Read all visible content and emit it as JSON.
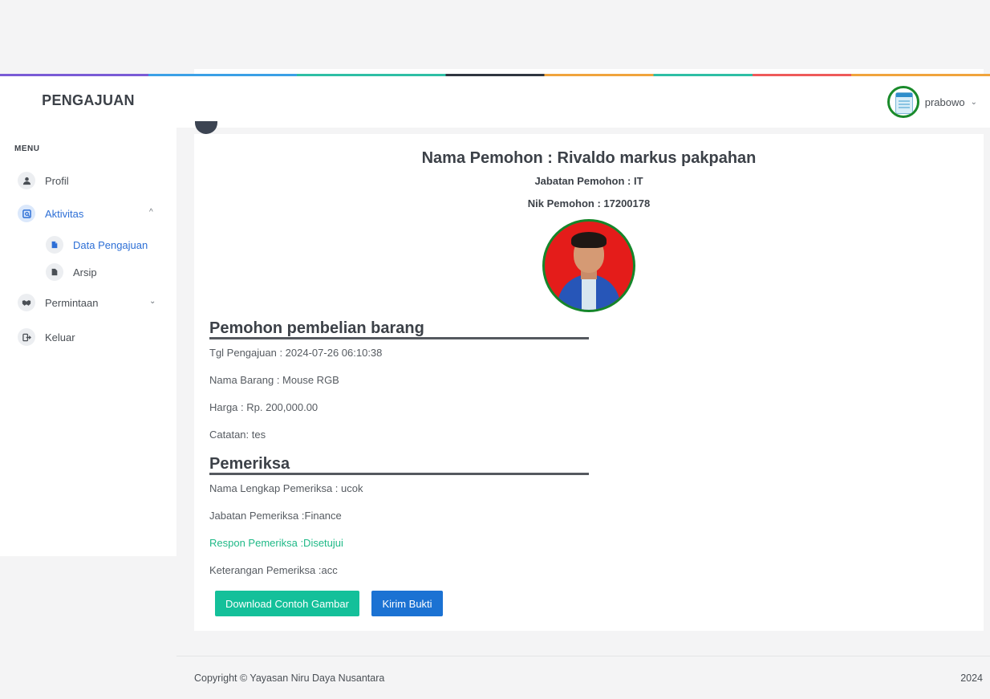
{
  "sidebar": {
    "brand": "PENGAJUAN",
    "menu_label": "MENU",
    "items": [
      {
        "label": "Profil",
        "icon": "user-icon"
      },
      {
        "label": "Aktivitas",
        "icon": "activity-icon"
      },
      {
        "label": "Permintaan",
        "icon": "handshake-icon"
      },
      {
        "label": "Keluar",
        "icon": "logout-icon"
      }
    ],
    "subitems": [
      {
        "label": "Data Pengajuan",
        "icon": "file-icon"
      },
      {
        "label": "Arsip",
        "icon": "file-icon"
      }
    ]
  },
  "header": {
    "username": "prabowo"
  },
  "applicant": {
    "name_line": "Nama Pemohon : Rivaldo markus pakpahan",
    "position_line": "Jabatan Pemohon : IT",
    "nik_line": "Nik Pemohon : 17200178"
  },
  "purchase": {
    "heading": "Pemohon pembelian barang",
    "date": "Tgl Pengajuan : 2024-07-26 06:10:38",
    "item": "Nama Barang : Mouse RGB",
    "price": "Harga : Rp. 200,000.00",
    "note": "Catatan: tes"
  },
  "reviewer": {
    "heading": "Pemeriksa",
    "name": "Nama Lengkap Pemeriksa : ucok",
    "position": "Jabatan Pemeriksa :Finance",
    "response": "Respon Pemeriksa :Disetujui",
    "remark": "Keterangan Pemeriksa :acc"
  },
  "actions": {
    "download": "Download Contoh Gambar",
    "send": "Kirim Bukti"
  },
  "footer": {
    "copyright": "Copyright © Yayasan Niru Daya Nusantara",
    "year": "2024"
  },
  "colors": {
    "accent_blue": "#1b72d3",
    "success_green": "#14c09a",
    "approved_text": "#1fb987",
    "avatar_ring": "#15862a"
  }
}
